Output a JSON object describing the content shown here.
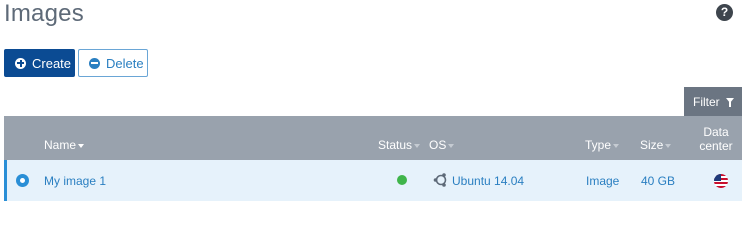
{
  "page": {
    "title": "Images"
  },
  "toolbar": {
    "create_label": "Create",
    "delete_label": "Delete",
    "filter_label": "Filter"
  },
  "table": {
    "headers": {
      "name": "Name",
      "status": "Status",
      "os": "OS",
      "type": "Type",
      "size": "Size",
      "datacenter_line1": "Data",
      "datacenter_line2": "center"
    },
    "rows": [
      {
        "name": "My image 1",
        "status": "active",
        "os": "Ubuntu 14.04",
        "os_icon": "ubuntu-icon",
        "type": "Image",
        "size": "40 GB",
        "datacenter_icon": "us-flag-icon"
      }
    ]
  },
  "colors": {
    "primary": "#0b4b93",
    "link": "#2a7fc1",
    "header_bg": "#99a2ad",
    "selected_row_bg": "#e6f2fb",
    "status_active": "#3fb54a"
  }
}
